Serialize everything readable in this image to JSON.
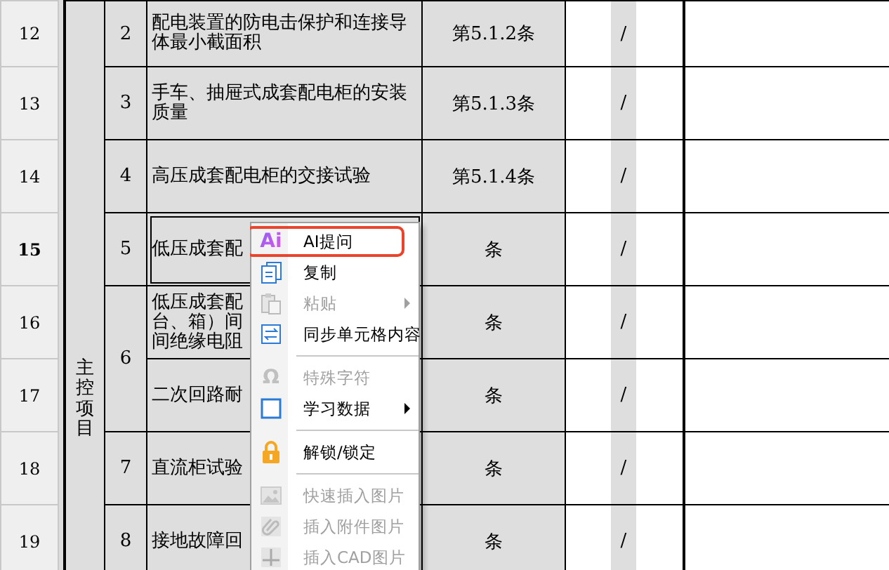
{
  "table": {
    "group": {
      "label": "主控项目"
    },
    "items": [
      {
        "number": "2",
        "rows": [
          {
            "row_header": "12",
            "selected": false,
            "description": "配电装置的防电击保护和连接导体最小截面积",
            "reference": "第5.1.2条",
            "column_8": "/"
          }
        ]
      },
      {
        "number": "3",
        "rows": [
          {
            "row_header": "13",
            "selected": false,
            "description": "手车、抽屉式成套配电柜的安装质量",
            "reference": "第5.1.3条",
            "column_8": "/"
          }
        ]
      },
      {
        "number": "4",
        "rows": [
          {
            "row_header": "14",
            "selected": false,
            "description": "高压成套配电柜的交接试验",
            "reference": "第5.1.4条",
            "column_8": "/"
          }
        ]
      },
      {
        "number": "5",
        "rows": [
          {
            "row_header": "15",
            "selected": true,
            "description": "低压成套配",
            "reference": "条",
            "column_8": "/"
          }
        ]
      },
      {
        "number": "6",
        "rows": [
          {
            "row_header": "16",
            "selected": false,
            "description_lines": [
              "低压成套配",
              "台、箱）间",
              "间绝缘电阻"
            ],
            "reference": "条",
            "column_8": "/"
          },
          {
            "row_header": "17",
            "selected": false,
            "description": "二次回路耐",
            "reference": "条",
            "column_8": "/"
          }
        ]
      },
      {
        "number": "7",
        "rows": [
          {
            "row_header": "18",
            "selected": false,
            "description": "直流柜试验",
            "reference": "条",
            "column_8": "/"
          }
        ]
      },
      {
        "number": "8",
        "rows": [
          {
            "row_header": "19",
            "selected": false,
            "description": "接地故障回",
            "reference": "条",
            "column_8": "/"
          }
        ]
      }
    ]
  },
  "context_menu": {
    "items": [
      {
        "kind": "item",
        "label": "AI提问",
        "icon_text": "Ai",
        "highlighted": true,
        "disabled": false,
        "submenu": false
      },
      {
        "kind": "item",
        "label": "复制",
        "highlighted": false,
        "disabled": false,
        "submenu": false
      },
      {
        "kind": "item",
        "label": "粘贴",
        "highlighted": false,
        "disabled": true,
        "submenu": true
      },
      {
        "kind": "item",
        "label": "同步单元格内容",
        "highlighted": false,
        "disabled": false,
        "submenu": false
      },
      {
        "kind": "separator"
      },
      {
        "kind": "item",
        "label": "特殊字符",
        "icon_text": "Ω",
        "highlighted": false,
        "disabled": true,
        "submenu": false
      },
      {
        "kind": "item",
        "label": "学习数据",
        "highlighted": false,
        "disabled": false,
        "submenu": true
      },
      {
        "kind": "separator"
      },
      {
        "kind": "item",
        "label": "解锁/锁定",
        "highlighted": false,
        "disabled": false,
        "submenu": false
      },
      {
        "kind": "separator"
      },
      {
        "kind": "item",
        "label": "快速插入图片",
        "highlighted": false,
        "disabled": true,
        "submenu": false
      },
      {
        "kind": "item",
        "label": "插入附件图片",
        "highlighted": false,
        "disabled": true,
        "submenu": false
      },
      {
        "kind": "item",
        "label": "插入CAD图片",
        "highlighted": false,
        "disabled": true,
        "submenu": false
      }
    ]
  }
}
